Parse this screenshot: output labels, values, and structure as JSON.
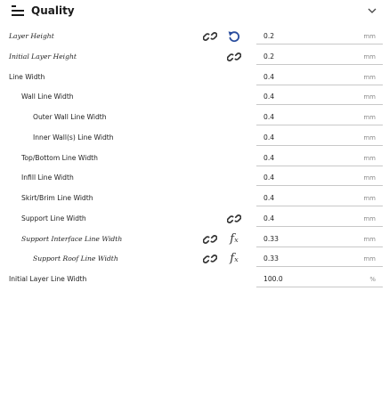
{
  "header": {
    "title": "Quality",
    "icon": "hamburger-icon",
    "collapse_icon": "chevron-down-icon"
  },
  "settings": [
    {
      "label": "Layer Height",
      "value": "0.2",
      "unit": "mm",
      "indent": 0,
      "italic": true,
      "icons": [
        "unlink-icon",
        "reset-icon"
      ]
    },
    {
      "label": "Initial Layer Height",
      "value": "0.2",
      "unit": "mm",
      "indent": 0,
      "italic": true,
      "icons": [
        "",
        "unlink-icon"
      ]
    },
    {
      "label": "Line Width",
      "value": "0.4",
      "unit": "mm",
      "indent": 0,
      "italic": false,
      "icons": []
    },
    {
      "label": "Wall Line Width",
      "value": "0.4",
      "unit": "mm",
      "indent": 1,
      "italic": false,
      "icons": []
    },
    {
      "label": "Outer Wall Line Width",
      "value": "0.4",
      "unit": "mm",
      "indent": 2,
      "italic": false,
      "icons": []
    },
    {
      "label": "Inner Wall(s) Line Width",
      "value": "0.4",
      "unit": "mm",
      "indent": 2,
      "italic": false,
      "icons": []
    },
    {
      "label": "Top/Bottom Line Width",
      "value": "0.4",
      "unit": "mm",
      "indent": 1,
      "italic": false,
      "icons": []
    },
    {
      "label": "Infill Line Width",
      "value": "0.4",
      "unit": "mm",
      "indent": 1,
      "italic": false,
      "icons": []
    },
    {
      "label": "Skirt/Brim Line Width",
      "value": "0.4",
      "unit": "mm",
      "indent": 1,
      "italic": false,
      "icons": []
    },
    {
      "label": "Support Line Width",
      "value": "0.4",
      "unit": "mm",
      "indent": 1,
      "italic": false,
      "icons": [
        "",
        "unlink-icon"
      ]
    },
    {
      "label": "Support Interface Line Width",
      "value": "0.33",
      "unit": "mm",
      "indent": 1,
      "italic": true,
      "icons": [
        "unlink-icon",
        "function-icon"
      ]
    },
    {
      "label": "Support Roof Line Width",
      "value": "0.33",
      "unit": "mm",
      "indent": 2,
      "italic": true,
      "icons": [
        "unlink-icon",
        "function-icon"
      ]
    },
    {
      "label": "Initial Layer Line Width",
      "value": "100.0",
      "unit": "%",
      "indent": 0,
      "italic": false,
      "icons": []
    }
  ]
}
